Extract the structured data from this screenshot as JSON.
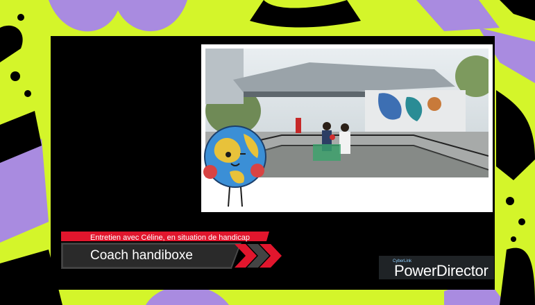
{
  "lower_third": {
    "subtitle": "Entretien avec Céline, en situation de handicap",
    "title": "Coach handiboxe"
  },
  "watermark": {
    "brand": "CyberLink",
    "product": "PowerDirector"
  },
  "colors": {
    "background_yellow": "#d4f52a",
    "accent_purple": "#a98be0",
    "lower_third_red": "#e1162d"
  }
}
